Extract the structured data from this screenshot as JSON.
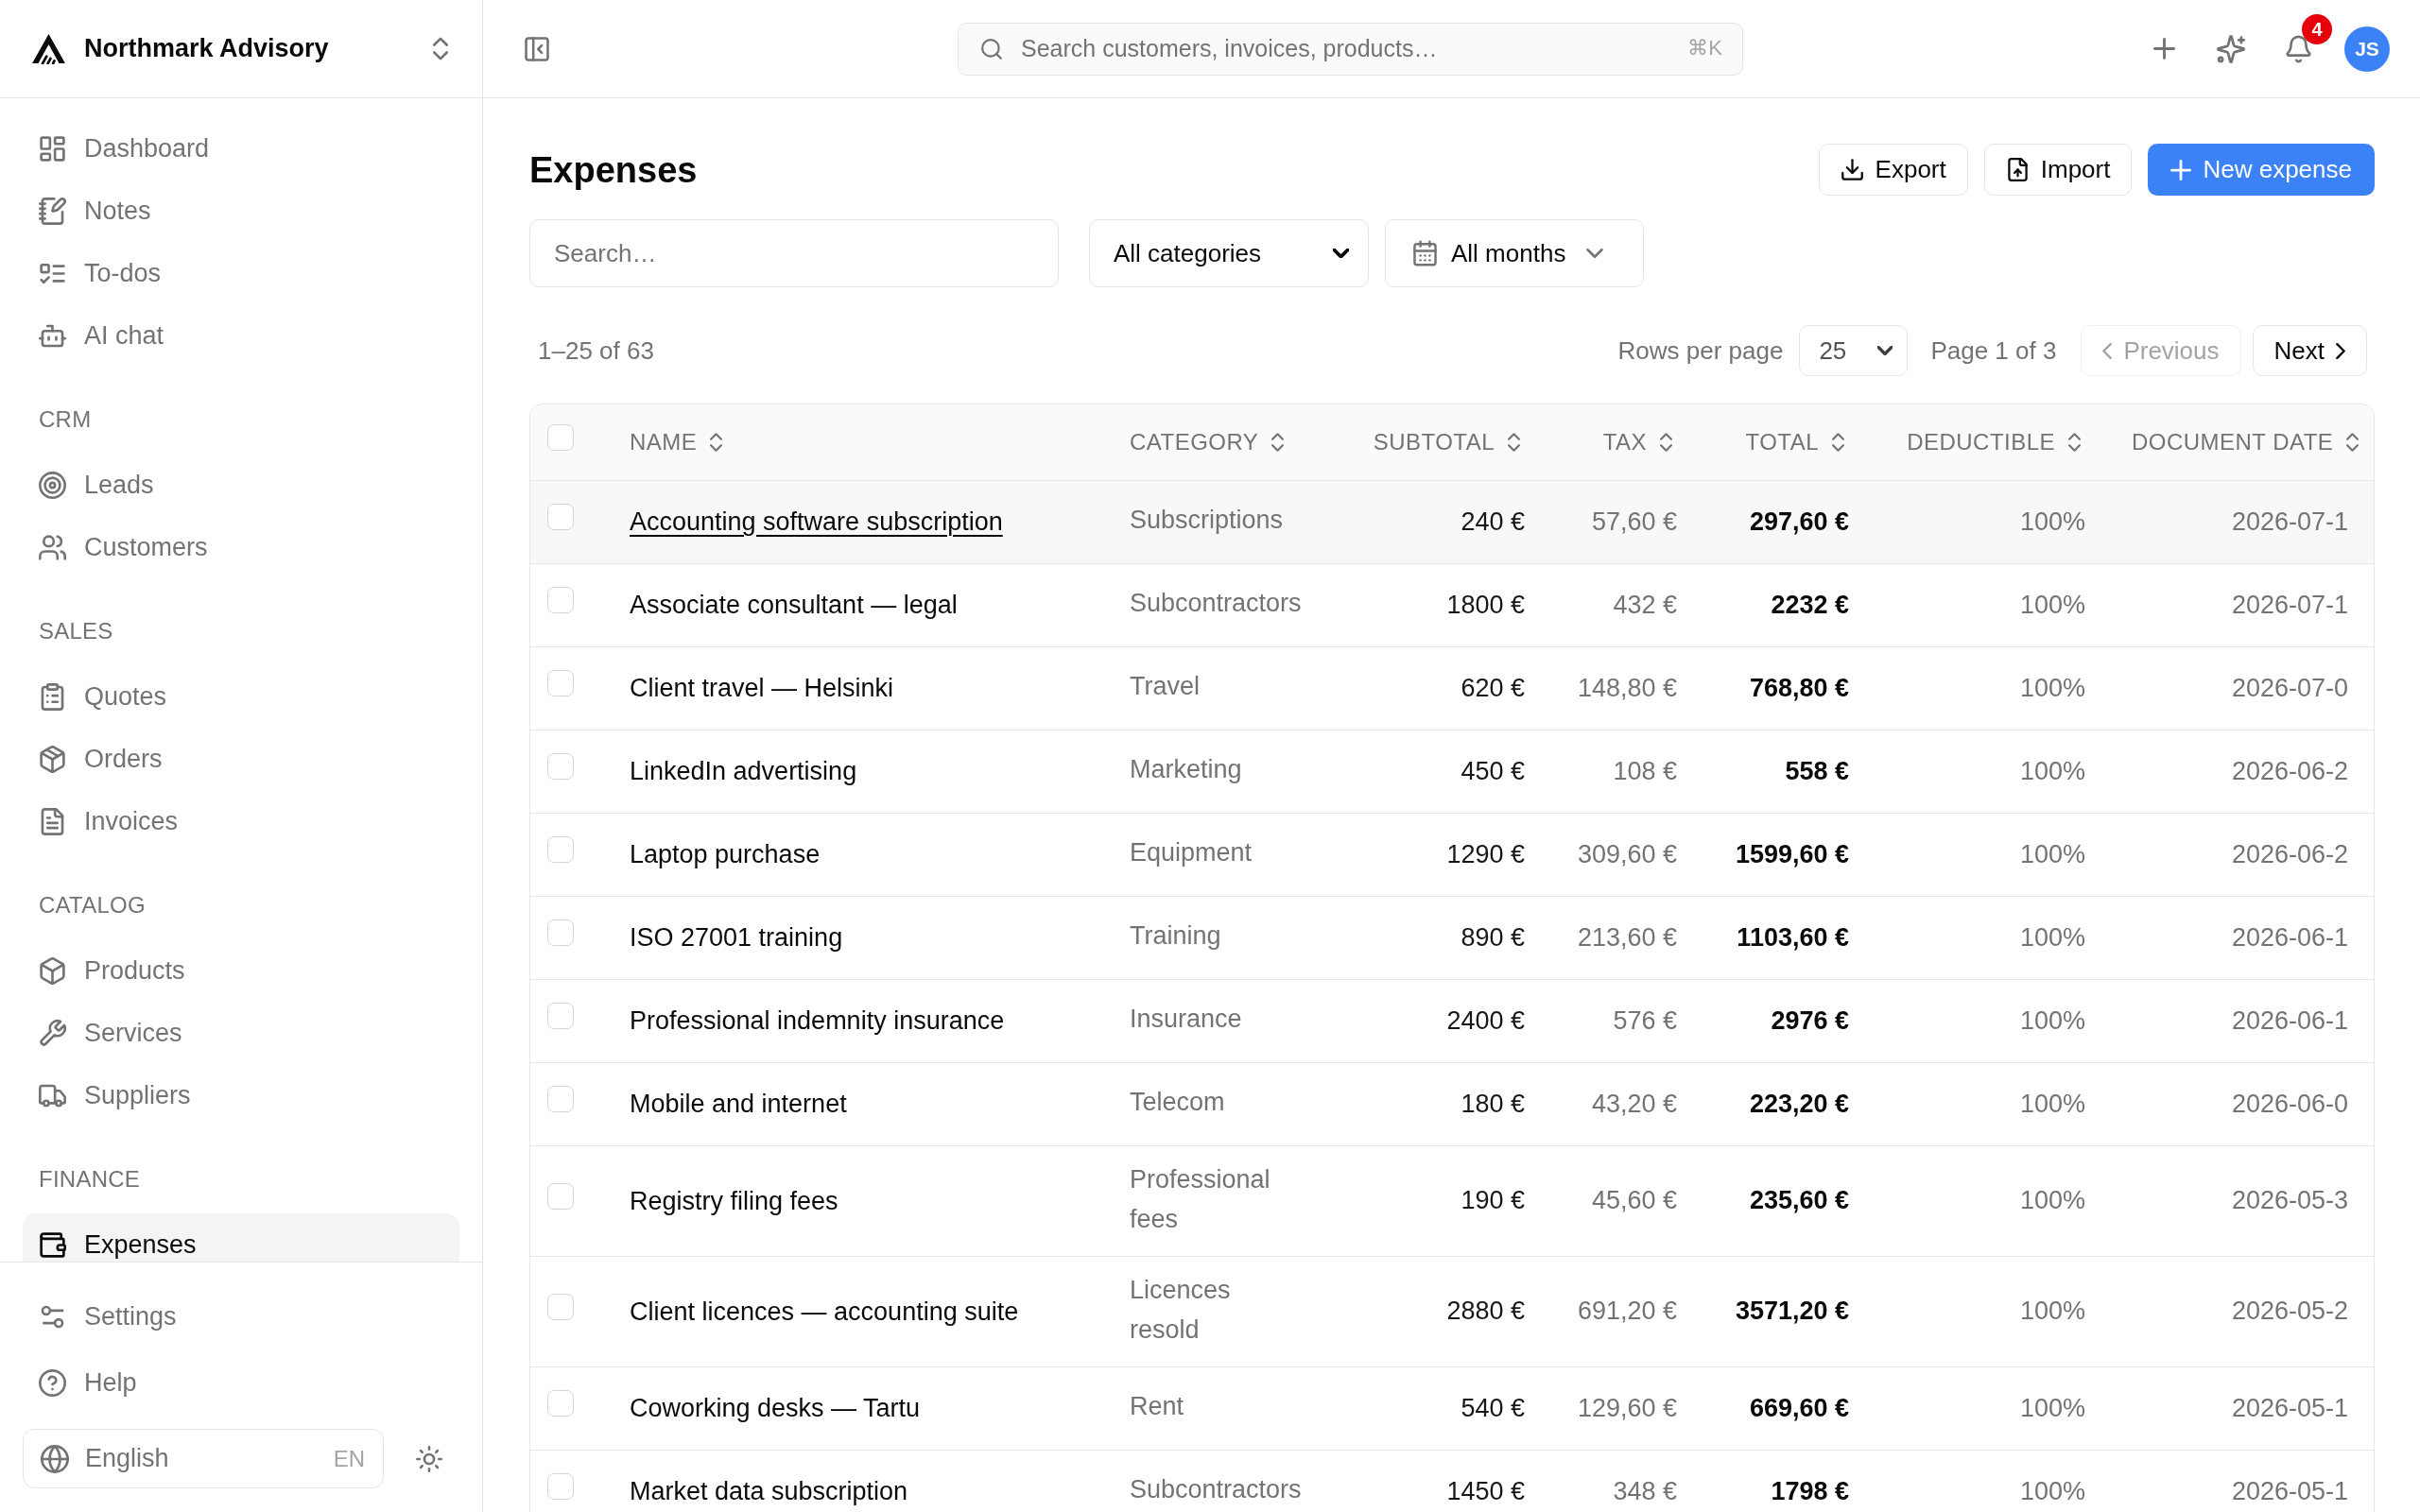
{
  "sidebar": {
    "workspace": {
      "name": "Northmark Advisory"
    },
    "sections": [
      {
        "items": [
          {
            "label": "Dashboard",
            "selected": false
          },
          {
            "label": "Notes",
            "selected": false
          },
          {
            "label": "To-dos",
            "selected": false
          },
          {
            "label": "AI chat",
            "selected": false
          }
        ]
      },
      {
        "title": "CRM",
        "items": [
          {
            "label": "Leads",
            "selected": false
          },
          {
            "label": "Customers",
            "selected": false
          }
        ]
      },
      {
        "title": "SALES",
        "items": [
          {
            "label": "Quotes",
            "selected": false
          },
          {
            "label": "Orders",
            "selected": false
          },
          {
            "label": "Invoices",
            "selected": false
          }
        ]
      },
      {
        "title": "CATALOG",
        "items": [
          {
            "label": "Products",
            "selected": false
          },
          {
            "label": "Services",
            "selected": false
          },
          {
            "label": "Suppliers",
            "selected": false
          }
        ]
      },
      {
        "title": "FINANCE",
        "items": [
          {
            "label": "Expenses",
            "selected": true
          }
        ]
      }
    ],
    "footer_items": [
      {
        "label": "Settings",
        "selected": false
      },
      {
        "label": "Help",
        "selected": false
      }
    ],
    "language": {
      "label": "English",
      "code": "EN"
    }
  },
  "topbar": {
    "search": {
      "placeholder": "Search customers, invoices, products…",
      "shortcut": "⌘K"
    },
    "notifications": {
      "count": "4"
    },
    "user": {
      "initials": "JS"
    }
  },
  "page": {
    "title": "Expenses",
    "actions": [
      {
        "label": "Export",
        "kind": "secondary"
      },
      {
        "label": "Import",
        "kind": "secondary"
      },
      {
        "label": "New expense",
        "kind": "primary"
      }
    ],
    "filters": {
      "search": {
        "placeholder": "Search…"
      },
      "category": {
        "value": "All categories"
      },
      "month": {
        "value": "All months"
      }
    },
    "pagination": {
      "range": "1–25 of 63",
      "rows_per_page_label": "Rows per page",
      "rows_per_page": "25",
      "page_label": "Page 1 of 3",
      "previous": {
        "label": "Previous",
        "disabled": true
      },
      "next": {
        "label": "Next",
        "disabled": false
      }
    },
    "table": {
      "select_all": {
        "checked": false
      },
      "columns": [
        {
          "label": "NAME"
        },
        {
          "label": "CATEGORY"
        },
        {
          "label": "SUBTOTAL"
        },
        {
          "label": "TAX"
        },
        {
          "label": "TOTAL"
        },
        {
          "label": "DEDUCTIBLE"
        },
        {
          "label": "DOCUMENT DATE"
        }
      ],
      "rows": [
        {
          "name": "Accounting software subscription",
          "category": "Subscriptions",
          "subtotal": "240 €",
          "tax": "57,60 €",
          "total": "297,60 €",
          "deductible": "100%",
          "document_date": "2026-07-1",
          "checked": false,
          "hovered": true
        },
        {
          "name": "Associate consultant — legal",
          "category": "Subcontractors",
          "subtotal": "1800 €",
          "tax": "432 €",
          "total": "2232 €",
          "deductible": "100%",
          "document_date": "2026-07-1",
          "checked": false,
          "hovered": false
        },
        {
          "name": "Client travel — Helsinki",
          "category": "Travel",
          "subtotal": "620 €",
          "tax": "148,80 €",
          "total": "768,80 €",
          "deductible": "100%",
          "document_date": "2026-07-0",
          "checked": false,
          "hovered": false
        },
        {
          "name": "LinkedIn advertising",
          "category": "Marketing",
          "subtotal": "450 €",
          "tax": "108 €",
          "total": "558 €",
          "deductible": "100%",
          "document_date": "2026-06-2",
          "checked": false,
          "hovered": false
        },
        {
          "name": "Laptop purchase",
          "category": "Equipment",
          "subtotal": "1290 €",
          "tax": "309,60 €",
          "total": "1599,60 €",
          "deductible": "100%",
          "document_date": "2026-06-2",
          "checked": false,
          "hovered": false
        },
        {
          "name": "ISO 27001 training",
          "category": "Training",
          "subtotal": "890 €",
          "tax": "213,60 €",
          "total": "1103,60 €",
          "deductible": "100%",
          "document_date": "2026-06-1",
          "checked": false,
          "hovered": false
        },
        {
          "name": "Professional indemnity insurance",
          "category": "Insurance",
          "subtotal": "2400 €",
          "tax": "576 €",
          "total": "2976 €",
          "deductible": "100%",
          "document_date": "2026-06-1",
          "checked": false,
          "hovered": false
        },
        {
          "name": "Mobile and internet",
          "category": "Telecom",
          "subtotal": "180 €",
          "tax": "43,20 €",
          "total": "223,20 €",
          "deductible": "100%",
          "document_date": "2026-06-0",
          "checked": false,
          "hovered": false
        },
        {
          "name": "Registry filing fees",
          "category": "Professional fees",
          "subtotal": "190 €",
          "tax": "45,60 €",
          "total": "235,60 €",
          "deductible": "100%",
          "document_date": "2026-05-3",
          "checked": false,
          "hovered": false
        },
        {
          "name": "Client licences — accounting suite",
          "category": "Licences resold",
          "subtotal": "2880 €",
          "tax": "691,20 €",
          "total": "3571,20 €",
          "deductible": "100%",
          "document_date": "2026-05-2",
          "checked": false,
          "hovered": false
        },
        {
          "name": "Coworking desks — Tartu",
          "category": "Rent",
          "subtotal": "540 €",
          "tax": "129,60 €",
          "total": "669,60 €",
          "deductible": "100%",
          "document_date": "2026-05-1",
          "checked": false,
          "hovered": false
        },
        {
          "name": "Market data subscription",
          "category": "Subcontractors",
          "subtotal": "1450 €",
          "tax": "348 €",
          "total": "1798 €",
          "deductible": "100%",
          "document_date": "2026-05-1",
          "checked": false,
          "hovered": false
        }
      ]
    }
  }
}
